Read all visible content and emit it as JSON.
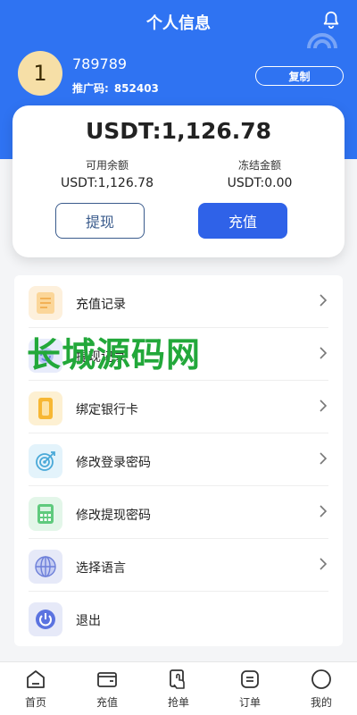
{
  "header": {
    "title": "个人信息",
    "icons": [
      "bell-icon"
    ]
  },
  "profile": {
    "avatar_text": "1",
    "username": "789789",
    "promo_label": "推广码:",
    "promo_code": "852403",
    "copy_label": "复制"
  },
  "balance_card": {
    "total": "USDT:1,126.78",
    "available_label": "可用余额",
    "available_value": "USDT:1,126.78",
    "frozen_label": "冻结金额",
    "frozen_value": "USDT:0.00",
    "withdraw_label": "提现",
    "recharge_label": "充值"
  },
  "menu": {
    "items": [
      {
        "label": "充值记录",
        "icon": "recharge-record-icon"
      },
      {
        "label": "提现记录",
        "icon": "withdraw-record-icon"
      },
      {
        "label": "绑定银行卡",
        "icon": "bank-card-icon"
      },
      {
        "label": "修改登录密码",
        "icon": "target-icon"
      },
      {
        "label": "修改提现密码",
        "icon": "calculator-icon"
      },
      {
        "label": "选择语言",
        "icon": "globe-icon"
      },
      {
        "label": "退出",
        "icon": "power-icon"
      }
    ]
  },
  "watermark": "长城源码网",
  "tabbar": {
    "items": [
      {
        "label": "首页",
        "icon": "home-icon"
      },
      {
        "label": "充值",
        "icon": "wallet-icon"
      },
      {
        "label": "抢单",
        "icon": "grab-order-icon"
      },
      {
        "label": "订单",
        "icon": "order-icon"
      },
      {
        "label": "我的",
        "icon": "profile-circle-icon"
      }
    ]
  },
  "colors": {
    "primary": "#2f73f2",
    "button_blue": "#2f62e8",
    "watermark_green": "#22a83a"
  }
}
